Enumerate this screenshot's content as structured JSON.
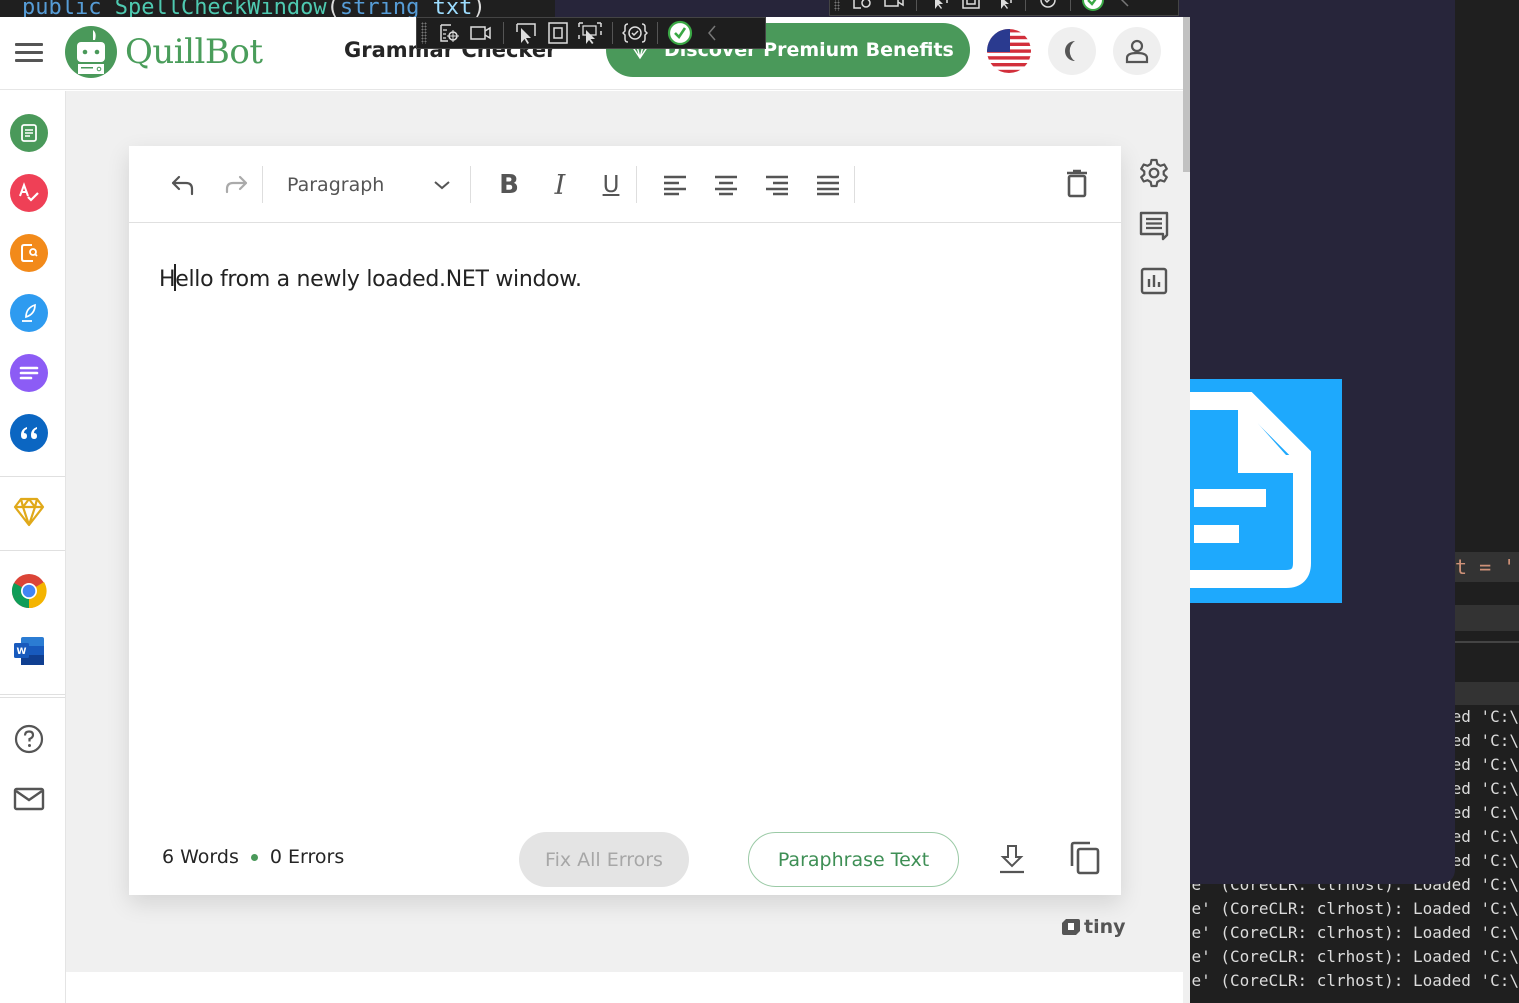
{
  "ide": {
    "top_code": {
      "prefix": "public ",
      "method": "SpellCheckWindow",
      "open": "(",
      "type": "string",
      "param": " txt",
      "close": ")"
    },
    "code_fragment": "t = '",
    "output_lines": [
      "ed 'C:\\",
      "ed 'C:\\",
      "ed 'C:\\",
      "ed 'C:\\",
      "ed 'C:\\",
      "ed 'C:\\",
      "ed 'C:\\",
      "e' (CoreCLR: clrhost): Loaded 'C:\\",
      "e' (CoreCLR: clrhost): Loaded 'C:\\",
      "e' (CoreCLR: clrhost): Loaded 'C:\\",
      "e' (CoreCLR: clrhost): Loaded 'C:\\",
      "e' (CoreCLR: clrhost): Loaded 'C:\\"
    ],
    "file_tile_icon": "document-icon"
  },
  "debug_toolbar": {
    "buttons": [
      "select-element-icon",
      "record-icon",
      "pointer-select-icon",
      "adorner-icon",
      "track-focus-icon",
      "hot-reload-icon",
      "check-status-icon",
      "collapse-chevron-icon"
    ]
  },
  "header": {
    "brand": "QuillBot",
    "title": "Grammar Checker",
    "premium_label": "Discover Premium Benefits",
    "language_flag": "us-flag-icon",
    "theme_icon": "moon-icon",
    "profile_icon": "user-icon"
  },
  "sidebar": {
    "items": [
      {
        "name": "paraphraser",
        "icon": "paraphraser-icon",
        "color": "#4a995a"
      },
      {
        "name": "grammar-checker",
        "icon": "grammar-check-icon",
        "color": "#ef4056"
      },
      {
        "name": "plagiarism-checker",
        "icon": "plagiarism-icon",
        "color": "#f28a1a"
      },
      {
        "name": "co-writer",
        "icon": "quill-icon",
        "color": "#2e9bf0"
      },
      {
        "name": "summarizer",
        "icon": "summarizer-icon",
        "color": "#8c5cf5"
      },
      {
        "name": "citation-generator",
        "icon": "quote-icon",
        "color": "#0b66c2"
      },
      {
        "name": "premium",
        "icon": "diamond-icon",
        "color": "#e0a91a"
      },
      {
        "name": "chrome-extension",
        "icon": "chrome-icon"
      },
      {
        "name": "word-addin",
        "icon": "word-icon"
      },
      {
        "name": "help",
        "icon": "help-icon"
      },
      {
        "name": "contact",
        "icon": "mail-icon"
      }
    ]
  },
  "editor": {
    "toolbar": {
      "undo": "undo-icon",
      "redo": "redo-icon",
      "format_selected": "Paragraph",
      "bold": "B",
      "italic": "I",
      "underline": "U",
      "align": [
        "align-left-icon",
        "align-center-icon",
        "align-right-icon",
        "align-justify-icon"
      ],
      "delete": "trash-icon"
    },
    "content_first": "H",
    "content_rest": "ello from a newly loaded.NET window.",
    "stats": {
      "words": "6 Words",
      "errors": "0 Errors"
    },
    "fix_all_label": "Fix All Errors",
    "paraphrase_label": "Paraphrase Text",
    "side_tools": [
      "settings-icon",
      "comment-icon",
      "statistics-icon"
    ],
    "powered_by": "tiny"
  },
  "colors": {
    "brand_green": "#4a995a",
    "premium_button": "#4a995a",
    "file_tile": "#1ea9fd"
  }
}
